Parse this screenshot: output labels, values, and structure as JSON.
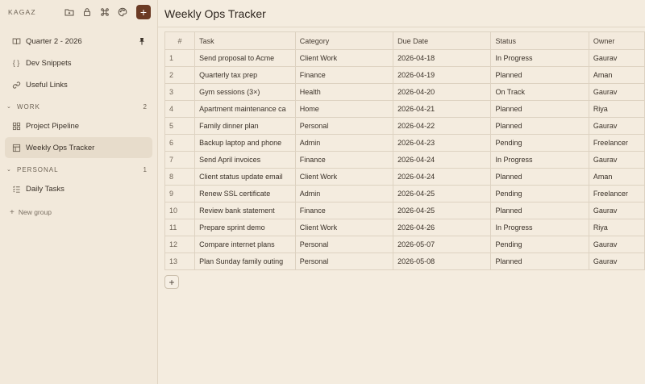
{
  "app": {
    "brand": "KAGAZ",
    "add_symbol": "+"
  },
  "sidebar": {
    "pinned": [
      {
        "label": "Quarter 2 - 2026",
        "icon": "book-icon",
        "pinned": true
      },
      {
        "label": "Dev Snippets",
        "icon": "braces-icon"
      },
      {
        "label": "Useful Links",
        "icon": "link-icon"
      }
    ],
    "groups": [
      {
        "name": "WORK",
        "count": "2",
        "items": [
          {
            "label": "Project Pipeline",
            "icon": "board-icon"
          },
          {
            "label": "Weekly Ops Tracker",
            "icon": "table-icon",
            "active": true
          }
        ]
      },
      {
        "name": "PERSONAL",
        "count": "1",
        "items": [
          {
            "label": "Daily Tasks",
            "icon": "checklist-icon"
          }
        ]
      }
    ],
    "new_group_label": "New group"
  },
  "page": {
    "title": "Weekly Ops Tracker"
  },
  "table": {
    "columns": [
      "#",
      "Task",
      "Category",
      "Due Date",
      "Status",
      "Owner"
    ],
    "rows": [
      [
        "1",
        "Send proposal to Acme",
        "Client Work",
        "2026-04-18",
        "In Progress",
        "Gaurav"
      ],
      [
        "2",
        "Quarterly tax prep",
        "Finance",
        "2026-04-19",
        "Planned",
        "Aman"
      ],
      [
        "3",
        "Gym sessions (3×)",
        "Health",
        "2026-04-20",
        "On Track",
        "Gaurav"
      ],
      [
        "4",
        "Apartment maintenance ca",
        "Home",
        "2026-04-21",
        "Planned",
        "Riya"
      ],
      [
        "5",
        "Family dinner plan",
        "Personal",
        "2026-04-22",
        "Planned",
        "Gaurav"
      ],
      [
        "6",
        "Backup laptop and phone",
        "Admin",
        "2026-04-23",
        "Pending",
        "Freelancer"
      ],
      [
        "7",
        "Send April invoices",
        "Finance",
        "2026-04-24",
        "In Progress",
        "Gaurav"
      ],
      [
        "8",
        "Client status update email",
        "Client Work",
        "2026-04-24",
        "Planned",
        "Aman"
      ],
      [
        "9",
        "Renew SSL certificate",
        "Admin",
        "2026-04-25",
        "Pending",
        "Freelancer"
      ],
      [
        "10",
        "Review bank statement",
        "Finance",
        "2026-04-25",
        "Planned",
        "Gaurav"
      ],
      [
        "11",
        "Prepare sprint demo",
        "Client Work",
        "2026-04-26",
        "In Progress",
        "Riya"
      ],
      [
        "12",
        "Compare internet plans",
        "Personal",
        "2026-05-07",
        "Pending",
        "Gaurav"
      ],
      [
        "13",
        "Plan Sunday family outing",
        "Personal",
        "2026-05-08",
        "Planned",
        "Gaurav"
      ]
    ],
    "add_row_symbol": "+"
  }
}
